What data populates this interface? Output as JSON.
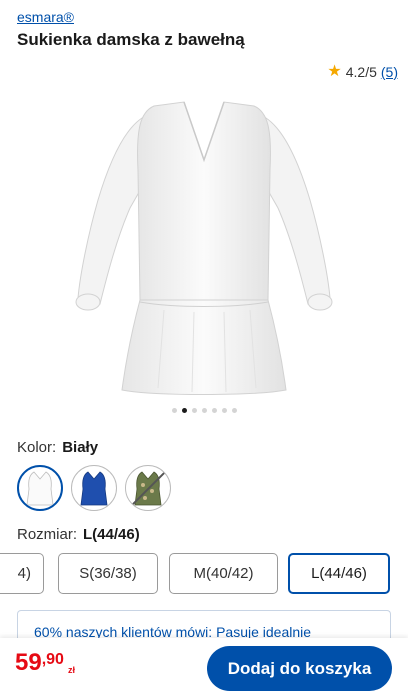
{
  "product": {
    "brand": "esmara®",
    "title": "Sukienka damska z bawełną",
    "rating_value": "4.2/5",
    "rating_count": "(5)"
  },
  "gallery": {
    "image_count": 7,
    "active_index": 1
  },
  "color": {
    "label": "Kolor:",
    "selected": "Biały",
    "swatches": [
      {
        "name": "white-dress",
        "color": "#ffffff",
        "selected": true,
        "available": true
      },
      {
        "name": "blue-dress",
        "color": "#1f4fae",
        "selected": false,
        "available": true
      },
      {
        "name": "green-print-dress",
        "color": "#6b7a4a",
        "selected": false,
        "available": false
      }
    ]
  },
  "size": {
    "label": "Rozmiar:",
    "selected": "L(44/46)",
    "options": [
      "4)",
      "S(36/38)",
      "M(40/42)",
      "L(44/46)"
    ]
  },
  "promo": {
    "text": "60% naszych klientów mówi: Pasuje idealnie"
  },
  "purchase": {
    "price_whole": "59",
    "price_cents": ",90",
    "currency": "zł",
    "add_to_cart": "Dodaj do koszyka"
  },
  "colors": {
    "brand_blue": "#0050aa",
    "price_red": "#e60a14",
    "star_yellow": "#f5a800"
  }
}
